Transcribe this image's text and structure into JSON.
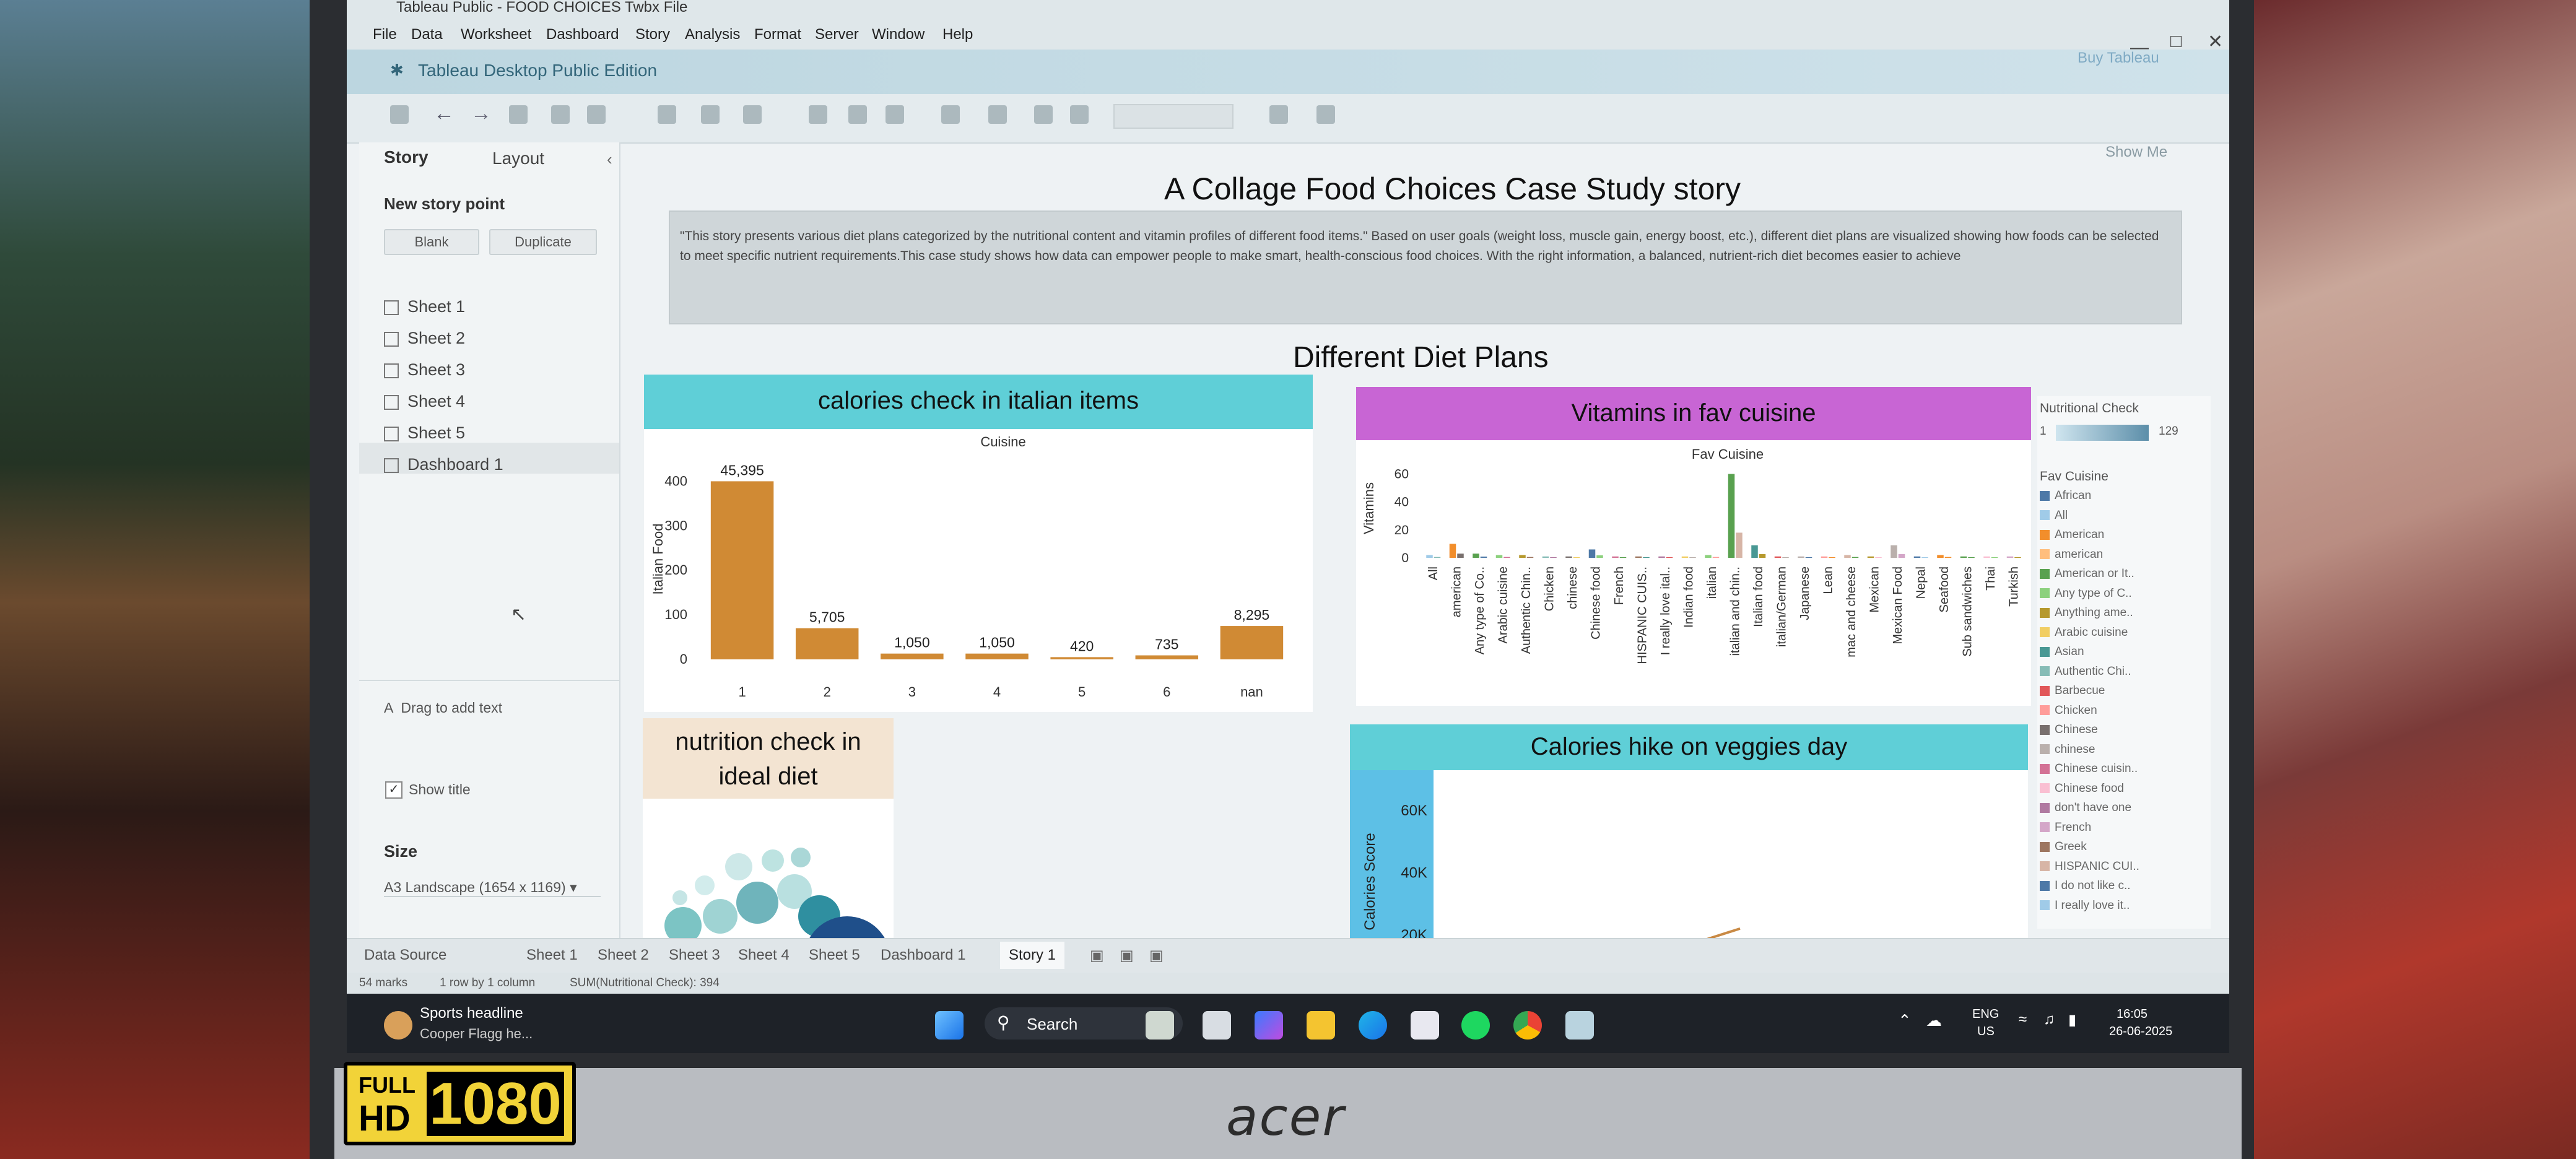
{
  "window": {
    "title": "Tableau Public - FOOD CHOICES Twbx File"
  },
  "menu": [
    "File",
    "Data",
    "Worksheet",
    "Dashboard",
    "Story",
    "Analysis",
    "Format",
    "Server",
    "Window",
    "Help"
  ],
  "app": {
    "name": "Tableau Desktop Public Edition",
    "buy": "Buy Tableau"
  },
  "left_pane": {
    "tabs": {
      "story": "Story",
      "layout": "Layout"
    },
    "new_story_point": "New story point",
    "blank": "Blank",
    "duplicate": "Duplicate",
    "sheets": [
      "Sheet 1",
      "Sheet 2",
      "Sheet 3",
      "Sheet 4",
      "Sheet 5",
      "Dashboard 1"
    ],
    "drag_text": "Drag to add text",
    "show_title": "Show title",
    "size_label": "Size",
    "size_value": "A3 Landscape (1654 x 1169)"
  },
  "show_me": "Show Me",
  "story": {
    "title": "A Collage Food Choices Case Study story",
    "description": "\"This story presents various diet plans categorized by the nutritional content and vitamin profiles of different food items.\" Based on user goals (weight loss, muscle gain, energy boost, etc.), different diet plans are visualized showing how foods can be selected to meet specific nutrient requirements.This case study shows how data can empower people to make smart, health-conscious food choices. With the right information, a balanced, nutrient-rich diet becomes easier to achieve"
  },
  "dashboard": {
    "title": "Different Diet Plans",
    "panel1_title": "calories check in italian items",
    "panel2_title": "Vitamins in fav cuisine",
    "panel3_title": "nutrition check in ideal diet",
    "panel4_title": "Calories hike on veggies day"
  },
  "chart_data": [
    {
      "type": "bar",
      "title": "calories check in italian items",
      "column_header": "Cuisine",
      "ylabel": "Italian Food",
      "categories": [
        "1",
        "2",
        "3",
        "4",
        "5",
        "6",
        "nan"
      ],
      "values": [
        400,
        70,
        13,
        13,
        5,
        9,
        75
      ],
      "data_labels": [
        "45,395",
        "5,705",
        "1,050",
        "1,050",
        "420",
        "735",
        "8,295"
      ],
      "yticks": [
        "400",
        "300",
        "200",
        "100",
        "0"
      ],
      "ylim": [
        0,
        420
      ],
      "color": "#d08a34"
    },
    {
      "type": "bar",
      "title": "Vitamins in fav cuisine",
      "column_header": "Fav Cuisine",
      "ylabel": "Vitamins",
      "yticks": [
        "60",
        "40",
        "20",
        "0"
      ],
      "ylim": [
        0,
        62
      ],
      "tick_labels": [
        "All",
        "american",
        "Any type of Co..",
        "Arabic cuisine",
        "Authentic Chin..",
        "Chicken",
        "chinese",
        "Chinese food",
        "French",
        "HISPANIC CUIS..",
        "I really love ital..",
        "Indian food",
        "italian",
        "italian and chin..",
        "Italian food",
        "italian/German",
        "Japanese",
        "Lean",
        "mac and cheese",
        "Mexican",
        "Mexican Food",
        "Nepal",
        "Seafood",
        "Sub sandwiches",
        "Thai",
        "Turkish"
      ],
      "values": [
        2,
        10,
        3,
        2,
        2,
        1,
        1,
        6,
        1,
        1,
        1,
        1,
        2,
        60,
        9,
        1,
        1,
        1,
        2,
        1,
        9,
        1,
        2,
        1,
        1,
        1
      ]
    },
    {
      "type": "line",
      "title": "Calories hike on veggies day",
      "ylabel": "Calories Score",
      "yticks": [
        "60K",
        "40K",
        "20K"
      ],
      "ylim": [
        15000,
        65000
      ],
      "x": [
        0,
        1
      ],
      "y": [
        15000,
        22000
      ]
    }
  ],
  "legend": {
    "nutritional_check_title": "Nutritional Check",
    "nutritional_min": "1",
    "nutritional_max": "129",
    "fav_cuisine_title": "Fav Cuisine",
    "items": [
      {
        "label": "African",
        "color": "#4e79a7"
      },
      {
        "label": "All",
        "color": "#a0cbe8"
      },
      {
        "label": "American",
        "color": "#f28e2b"
      },
      {
        "label": "american",
        "color": "#ffbe7d"
      },
      {
        "label": "American or It..",
        "color": "#59a14f"
      },
      {
        "label": "Any type of C..",
        "color": "#8cd17d"
      },
      {
        "label": "Anything ame..",
        "color": "#b6992d"
      },
      {
        "label": "Arabic cuisine",
        "color": "#f1ce63"
      },
      {
        "label": "Asian",
        "color": "#499894"
      },
      {
        "label": "Authentic Chi..",
        "color": "#86bcb6"
      },
      {
        "label": "Barbecue",
        "color": "#e15759"
      },
      {
        "label": "Chicken",
        "color": "#ff9d9a"
      },
      {
        "label": "Chinese",
        "color": "#79706e"
      },
      {
        "label": "chinese",
        "color": "#bab0ac"
      },
      {
        "label": "Chinese cuisin..",
        "color": "#d37295"
      },
      {
        "label": "Chinese food",
        "color": "#fabfd2"
      },
      {
        "label": "don't have one",
        "color": "#b07aa1"
      },
      {
        "label": "French",
        "color": "#d4a6c8"
      },
      {
        "label": "Greek",
        "color": "#9d7660"
      },
      {
        "label": "HISPANIC CUI..",
        "color": "#d7b5a6"
      },
      {
        "label": "I do not like c..",
        "color": "#4e79a7"
      },
      {
        "label": "I really love it..",
        "color": "#a0cbe8"
      }
    ]
  },
  "bottom_tabs": [
    "Data Source",
    "Sheet 1",
    "Sheet 2",
    "Sheet 3",
    "Sheet 4",
    "Sheet 5",
    "Dashboard 1",
    "Story 1"
  ],
  "status": {
    "marks": "54 marks",
    "rows": "1 row by 1 column",
    "sum": "SUM(Nutritional Check): 394"
  },
  "taskbar": {
    "news_title": "Sports headline",
    "news_sub": "Cooper Flagg he...",
    "search": "Search",
    "lang": "ENG",
    "region": "US",
    "time": "16:05",
    "date": "26-06-2025"
  },
  "badge": {
    "full": "FULL",
    "hd": "HD",
    "res": "1080"
  },
  "brand": "acer"
}
